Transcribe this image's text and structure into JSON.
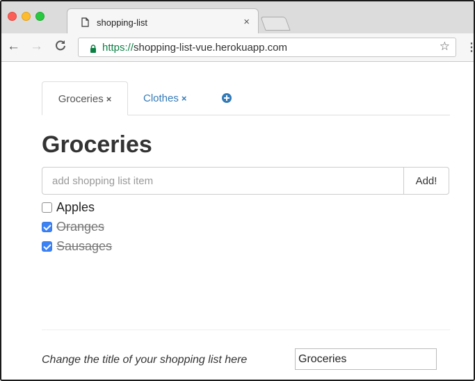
{
  "browser": {
    "tab_title": "shopping-list",
    "tab_close": "×",
    "url_scheme": "https://",
    "url_rest": "shopping-list-vue.herokuapp.com",
    "nav_back": "←",
    "nav_forward": "→",
    "nav_reload": "C",
    "star": "☆",
    "menu": "⋮"
  },
  "tabs": [
    {
      "label": "Groceries",
      "close": "×",
      "active": true
    },
    {
      "label": "Clothes",
      "close": "×",
      "active": false
    }
  ],
  "heading": "Groceries",
  "add_item": {
    "placeholder": "add shopping list item",
    "button_label": "Add!"
  },
  "items": [
    {
      "label": "Apples",
      "checked": false
    },
    {
      "label": "Oranges",
      "checked": true
    },
    {
      "label": "Sausages",
      "checked": true
    }
  ],
  "footer": {
    "label": "Change the title of your shopping list here",
    "title_value": "Groceries"
  },
  "colors": {
    "link": "#337ab7",
    "checkbox_checked": "#3c82f6",
    "https_green": "#0b8043"
  }
}
